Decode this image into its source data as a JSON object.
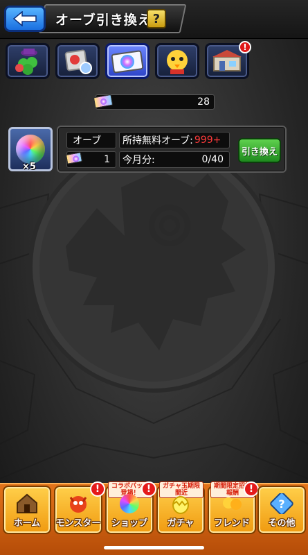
{
  "header": {
    "title": "オーブ引き換え",
    "help_label": "?"
  },
  "tabs": [
    {
      "name": "clover-hat",
      "active": false
    },
    {
      "name": "item-bag",
      "active": false
    },
    {
      "name": "rainbow-ticket",
      "active": true
    },
    {
      "name": "chick-monster",
      "active": false
    },
    {
      "name": "shop-building",
      "active": false,
      "badge": "!"
    }
  ],
  "ticket_balance": "28",
  "orb": {
    "multiplier": "×5",
    "label": "オーブ",
    "ticket_cost": "1",
    "free_label": "所持無料オーブ:",
    "free_value": "999+",
    "month_label": "今月分:",
    "month_value": "0/40",
    "exchange_button": "引き換え"
  },
  "navbar": {
    "items": [
      {
        "label": "ホーム",
        "icon": "house-icon"
      },
      {
        "label": "モンスター",
        "icon": "dragon-icon",
        "notice": "!"
      },
      {
        "label": "ショップ",
        "icon": "orb-icon",
        "notice": "!",
        "tag": "コラボパック登場！"
      },
      {
        "label": "ガチャ",
        "icon": "egg-icon",
        "tag": "ガチャ玉期限間近"
      },
      {
        "label": "フレンド",
        "icon": "friends-icon",
        "notice": "!",
        "tag": "期間限定招待報酬"
      },
      {
        "label": "その他",
        "icon": "question-icon"
      }
    ]
  },
  "colors": {
    "accent_red": "#ff3b3b",
    "button_green": "#2fa82a",
    "nav_orange": "#f09a10",
    "tab_active": "#4a62e8"
  }
}
